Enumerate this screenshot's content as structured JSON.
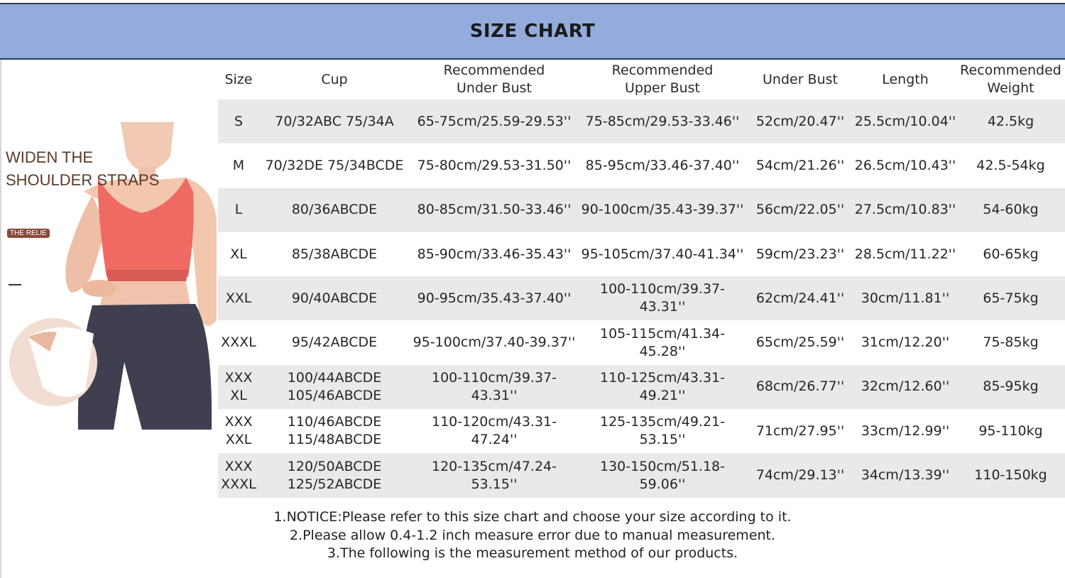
{
  "header": {
    "title": "SIZE CHART"
  },
  "promo": {
    "headline_line1": "WIDEN THE",
    "headline_line2": "SHOULDER STRAPS",
    "badge": "THE RELIE"
  },
  "table": {
    "headers": [
      "Size",
      "Cup",
      "Recommended\nUnder Bust",
      "Recommended\nUpper Bust",
      "Under Bust",
      "Length",
      "Recommended\nWeight"
    ],
    "rows": [
      [
        "S",
        "70/32ABC 75/34A",
        "65-75cm/25.59-29.53''",
        "75-85cm/29.53-33.46''",
        "52cm/20.47''",
        "25.5cm/10.04''",
        "42.5kg"
      ],
      [
        "M",
        "70/32DE 75/34BCDE",
        "75-80cm/29.53-31.50''",
        "85-95cm/33.46-37.40''",
        "54cm/21.26''",
        "26.5cm/10.43''",
        "42.5-54kg"
      ],
      [
        "L",
        "80/36ABCDE",
        "80-85cm/31.50-33.46''",
        "90-100cm/35.43-39.37''",
        "56cm/22.05''",
        "27.5cm/10.83''",
        "54-60kg"
      ],
      [
        "XL",
        "85/38ABCDE",
        "85-90cm/33.46-35.43''",
        "95-105cm/37.40-41.34''",
        "59cm/23.23''",
        "28.5cm/11.22''",
        "60-65kg"
      ],
      [
        "XXL",
        "90/40ABCDE",
        "90-95cm/35.43-37.40''",
        "100-110cm/39.37-\n43.31''",
        "62cm/24.41''",
        "30cm/11.81''",
        "65-75kg"
      ],
      [
        "XXXL",
        "95/42ABCDE",
        "95-100cm/37.40-39.37''",
        "105-115cm/41.34-\n45.28''",
        "65cm/25.59''",
        "31cm/12.20''",
        "75-85kg"
      ],
      [
        "XXX\nXL",
        "100/44ABCDE\n105/46ABCDE",
        "100-110cm/39.37-\n43.31''",
        "110-125cm/43.31-\n49.21''",
        "68cm/26.77''",
        "32cm/12.60''",
        "85-95kg"
      ],
      [
        "XXX\nXXL",
        "110/46ABCDE\n115/48ABCDE",
        "110-120cm/43.31-\n47.24''",
        "125-135cm/49.21-\n53.15''",
        "71cm/27.95''",
        "33cm/12.99''",
        "95-110kg"
      ],
      [
        "XXX\nXXXL",
        "120/50ABCDE\n125/52ABCDE",
        "120-135cm/47.24-\n53.15''",
        "130-150cm/51.18-\n59.06''",
        "74cm/29.13''",
        "34cm/13.39''",
        "110-150kg"
      ]
    ]
  },
  "notes": [
    "1.NOTICE:Please refer to this size chart and choose your size according to it.",
    "2.Please allow 0.4-1.2 inch measure error due to manual measurement.",
    "3.The following is the measurement method of our products."
  ],
  "colors": {
    "header_bg": "#93acdd",
    "row_shade": "#e9e9e9",
    "garment": "#ee6a62",
    "leggings": "#3f3f50"
  }
}
